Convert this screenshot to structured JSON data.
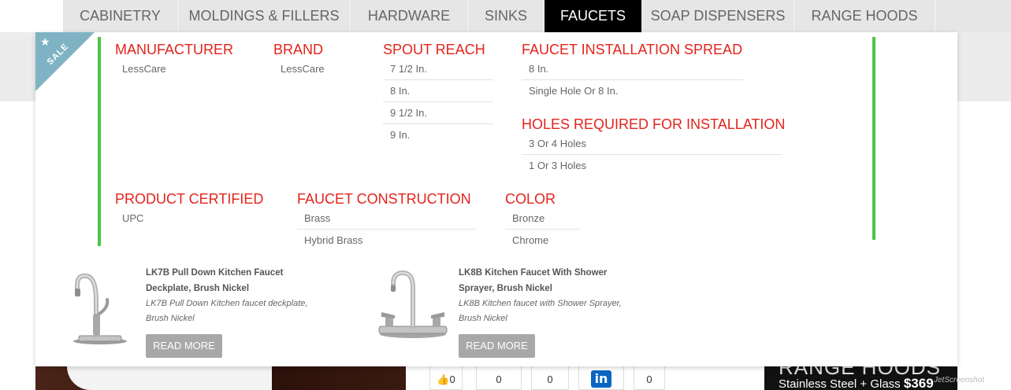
{
  "nav": {
    "tabs": [
      "CABINETRY",
      "MOLDINGS & FILLERS",
      "HARDWARE",
      "SINKS",
      "FAUCETS",
      "SOAP DISPENSERS",
      "RANGE HOODS"
    ],
    "active": "FAUCETS"
  },
  "menu": {
    "sale_label": "SALE",
    "facets": [
      {
        "title": "MANUFACTURER",
        "options": [
          "LessCare"
        ]
      },
      {
        "title": "BRAND",
        "options": [
          "LessCare"
        ]
      },
      {
        "title": "SPOUT REACH",
        "options": [
          "7 1/2 In.",
          "8 In.",
          "9 1/2 In.",
          "9 In."
        ]
      },
      {
        "title": "FAUCET INSTALLATION SPREAD",
        "options": [
          "8 In.",
          "Single Hole Or 8 In."
        ]
      },
      {
        "title": "HOLES REQUIRED FOR INSTALLATION",
        "options": [
          "3 Or 4 Holes",
          "1 Or 3 Holes"
        ]
      },
      {
        "title": "PRODUCT CERTIFIED",
        "options": [
          "UPC"
        ]
      },
      {
        "title": "FAUCET CONSTRUCTION",
        "options": [
          "Brass",
          "Hybrid Brass"
        ]
      },
      {
        "title": "COLOR",
        "options": [
          "Bronze",
          "Chrome"
        ]
      }
    ],
    "products": [
      {
        "title": "LK7B Pull Down Kitchen Faucet Deckplate, Brush Nickel",
        "description": "LK7B Pull Down Kitchen faucet deckplate, Brush Nickel",
        "button": "READ MORE"
      },
      {
        "title": "LK8B Kitchen Faucet With Shower Sprayer, Brush Nickel",
        "description": "LK8B Kitchen faucet with Shower Sprayer, Brush Nickel",
        "button": "READ MORE"
      }
    ]
  },
  "background": {
    "social_counts": [
      "0",
      "0",
      "0",
      "0"
    ],
    "linkedin_label": "in",
    "promo_title": "RANGE HOODS",
    "promo_text": "Stainless Steel + Glass",
    "promo_price": "$369",
    "watermark": "JetScreenshot"
  },
  "colors": {
    "facet_heading": "#e4231c",
    "accent_bar": "#4cc44c",
    "sale_ribbon": "#7fb3c4",
    "active_tab_bg": "#000000"
  }
}
